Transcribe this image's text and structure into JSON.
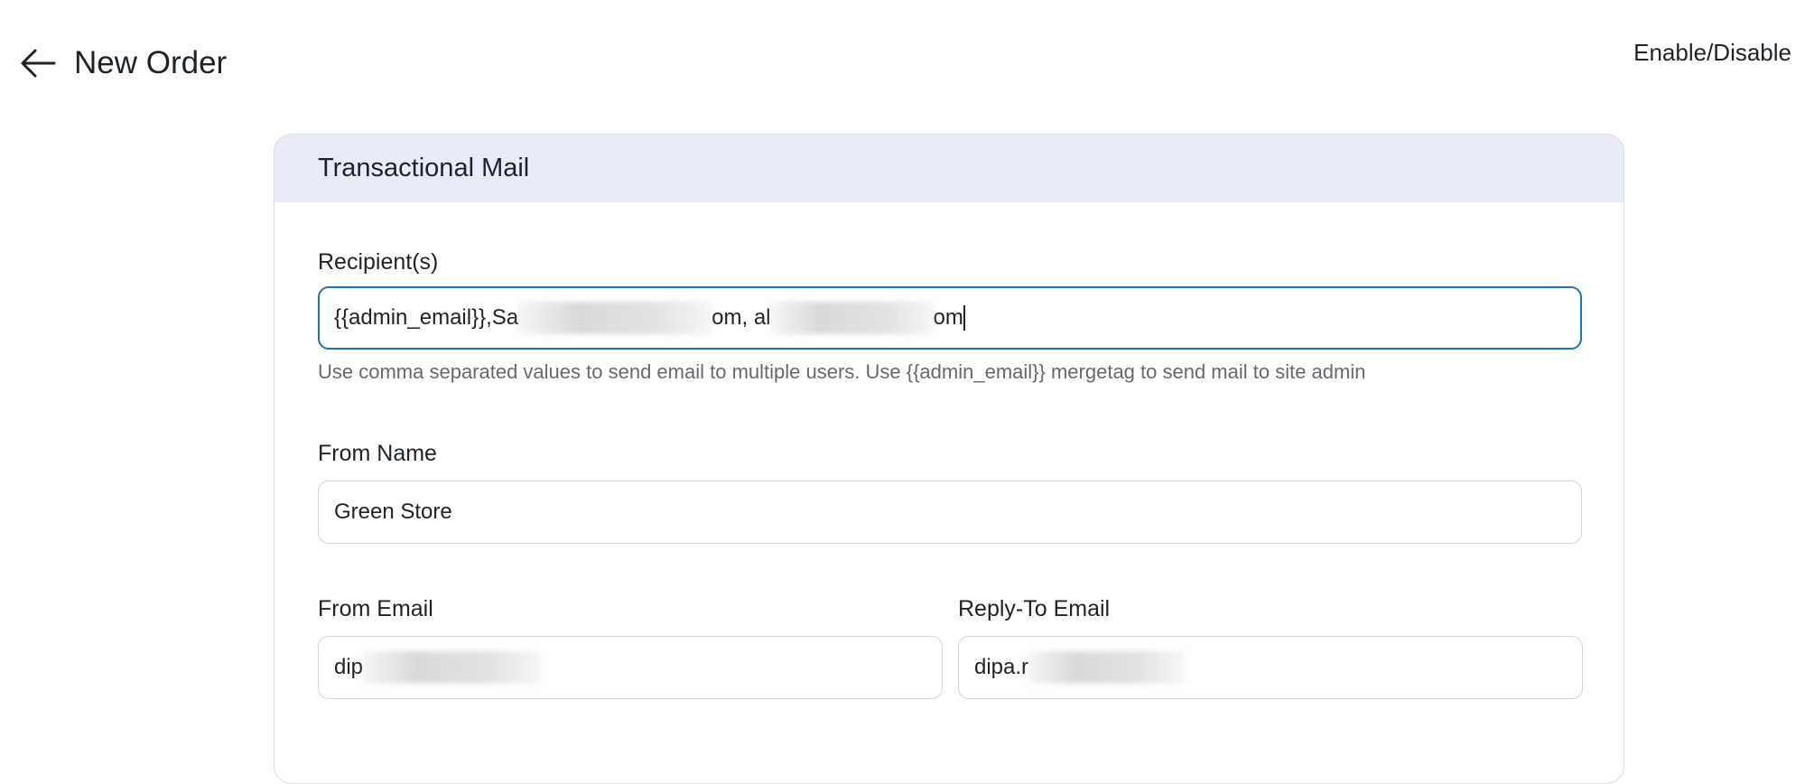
{
  "header": {
    "title": "New Order",
    "toggle_label": "Enable/Disable"
  },
  "card": {
    "title": "Transactional Mail"
  },
  "fields": {
    "recipients": {
      "label": "Recipient(s)",
      "value_part1": "{{admin_email}},Sa",
      "value_part2": "om, al",
      "value_part3": "om",
      "help": "Use comma separated values to send email to multiple users. Use {{admin_email}} mergetag to send mail to site admin"
    },
    "from_name": {
      "label": "From Name",
      "value": "Green Store"
    },
    "from_email": {
      "label": "From Email",
      "value_visible": "dip"
    },
    "reply_to": {
      "label": "Reply-To Email",
      "value_visible": "dipa.r"
    }
  },
  "icons": {
    "back": "arrow-left-icon"
  },
  "colors": {
    "card_header_bg": "#e8ecf9",
    "focus_border": "#2271b1",
    "help_text": "#646970"
  }
}
